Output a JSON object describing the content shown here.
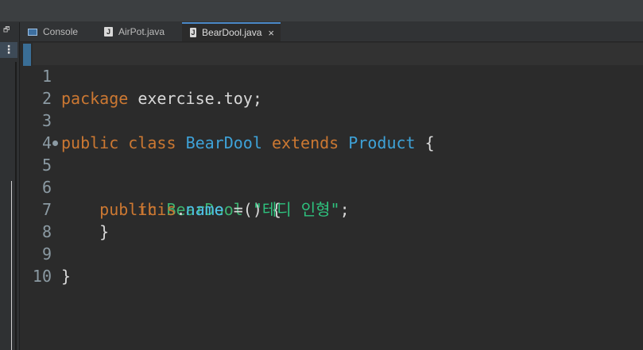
{
  "window": {
    "restore_icon": "restore-icon",
    "view_menu_glyph": "⋮"
  },
  "tabs": [
    {
      "label": "Console",
      "icon": "console-icon",
      "active": false
    },
    {
      "label": "AirPot.java",
      "icon": "java-file-icon",
      "active": false
    },
    {
      "label": "BearDool.java",
      "icon": "java-file-icon",
      "active": true,
      "close_glyph": "×"
    }
  ],
  "editor": {
    "lines": [
      {
        "number": "1",
        "tokens": {
          "kw1": "package",
          "rest": " exercise.toy;"
        }
      },
      {
        "number": "2"
      },
      {
        "number": "3",
        "tokens": {
          "kw1": "public",
          "kw2": "class",
          "cls1": "BearDool",
          "kw3": "extends",
          "cls2": "Product",
          "brace": "{"
        }
      },
      {
        "number": "4"
      },
      {
        "number": "5",
        "tokens": {
          "kw1": "public",
          "method": "BearDool",
          "rest": "() {"
        }
      },
      {
        "number": "6",
        "tokens": {
          "kw1": "this",
          "dot": ".",
          "field": "name",
          "eq": " = ",
          "str": "\"테디 인형\"",
          "semi": ";"
        }
      },
      {
        "number": "7",
        "tokens": {
          "brace": "}"
        }
      },
      {
        "number": "8"
      },
      {
        "number": "9",
        "tokens": {
          "brace": "}"
        }
      },
      {
        "number": "10"
      }
    ]
  },
  "colors": {
    "keyword": "#cc7832",
    "class_name": "#3ea2d8",
    "method_name": "#3cb371",
    "field": "#4fc1e9",
    "string": "#2ec27e",
    "line_number": "#8b9aa3",
    "background": "#2b2b2b"
  }
}
